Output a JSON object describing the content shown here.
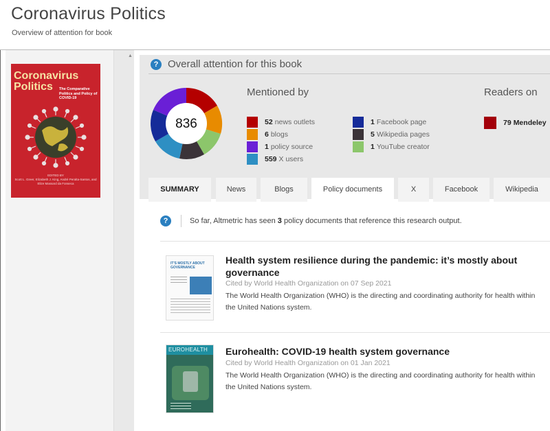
{
  "page": {
    "title": "Coronavirus Politics",
    "subtitle": "Overview of attention for book"
  },
  "book_cover": {
    "title_line1": "Coronavirus",
    "title_line2": "Politics",
    "subtitle": "The Comparative Politics and Policy of COVID-19",
    "edited_by": "EDITED BY",
    "editors": "Scott L. Greer, Elizabeth J. King, André Peralta-Santos, and Elize Massard da Fonseca",
    "bg_color": "#c8232c"
  },
  "attention": {
    "title": "Overall attention for this book",
    "score": "836",
    "mentioned_by_title": "Mentioned by",
    "readers_title": "Readers on",
    "mentions": [
      {
        "count": "52",
        "label": "news outlets",
        "color": "#b40000"
      },
      {
        "count": "6",
        "label": "blogs",
        "color": "#e88b00"
      },
      {
        "count": "1",
        "label": "policy source",
        "color": "#6a1fd6"
      },
      {
        "count": "559",
        "label": "X users",
        "color": "#2e8fc3"
      },
      {
        "count": "1",
        "label": "Facebook page",
        "color": "#152b99"
      },
      {
        "count": "5",
        "label": "Wikipedia pages",
        "color": "#3b3338"
      },
      {
        "count": "1",
        "label": "YouTube creator",
        "color": "#8cc66b"
      }
    ],
    "readers": [
      {
        "count": "79",
        "label": "Mendeley",
        "color": "#a3000a"
      }
    ]
  },
  "tabs": [
    {
      "label": "SUMMARY",
      "active": false
    },
    {
      "label": "News",
      "active": false
    },
    {
      "label": "Blogs",
      "active": false
    },
    {
      "label": "Policy documents",
      "active": true
    },
    {
      "label": "X",
      "active": false
    },
    {
      "label": "Facebook",
      "active": false
    },
    {
      "label": "Wikipedia",
      "active": false
    }
  ],
  "policy": {
    "intro_prefix": "So far, Altmetric has seen",
    "intro_count": "3",
    "intro_suffix": "policy documents that reference this research output.",
    "documents": [
      {
        "title": "Health system resilience during the pandemic: it’s mostly about governance",
        "cited": "Cited by World Health Organization on 07 Sep 2021",
        "description": "The World Health Organization (WHO) is the directing and coordinating authority for health within the United Nations system.",
        "thumb_heading": "IT'S MOSTLY ABOUT GOVERNANCE"
      },
      {
        "title": "Eurohealth: COVID-19 health system governance",
        "cited": "Cited by World Health Organization on 01 Jan 2021",
        "description": "The World Health Organization (WHO) is the directing and coordinating authority for health within the United Nations system.",
        "thumb_heading": "EUROHEALTH"
      }
    ]
  }
}
